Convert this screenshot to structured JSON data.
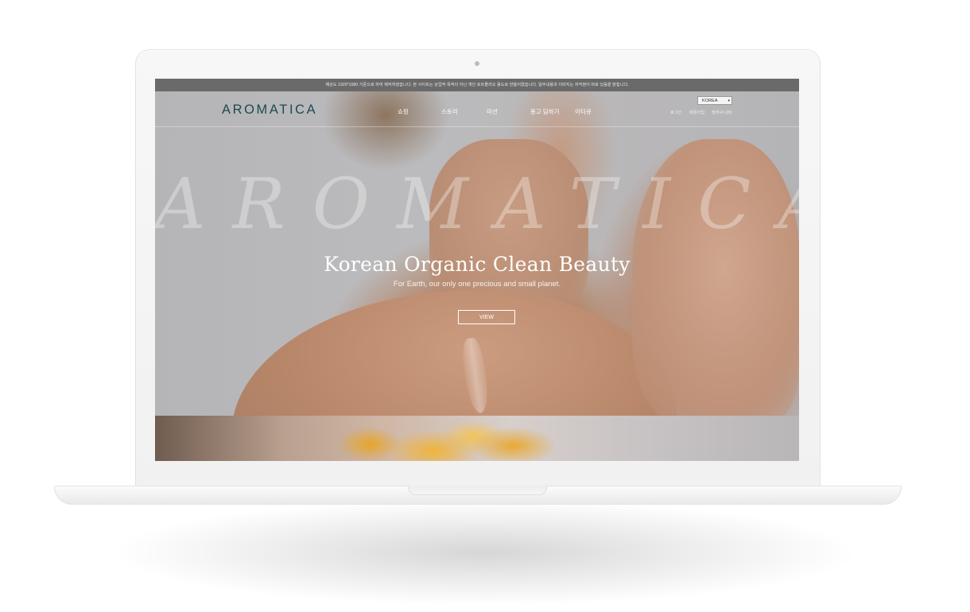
{
  "notice_bar": {
    "text": "해상도 1920*1080 기준으로 하여 제작하였습니다.   본 사이트는 상업적 목적이 아닌 개인 포트폴리오 용도로 만들어졌습니다.  일부내용과 이미지는 저작권이 따로 있음을 밝힙니다."
  },
  "header": {
    "logo": "AROMATICA",
    "nav": [
      {
        "label": "쇼핑"
      },
      {
        "label": "스토리"
      },
      {
        "label": "미션"
      },
      {
        "label": "용고 담하기"
      },
      {
        "label": "이티큐"
      }
    ],
    "language_select": {
      "value": "KOREA"
    },
    "utility_links": [
      {
        "label": "로그인"
      },
      {
        "label": "회원가입"
      },
      {
        "label": "장바구니(0)"
      }
    ]
  },
  "hero": {
    "watermark": "AROMATICA",
    "title": "Korean Organic Clean Beauty",
    "subtitle": "For Earth, our only one precious and small planet.",
    "button_label": "VIEW"
  },
  "colors": {
    "logo": "#1d4a4f",
    "notice_bar_bg": "#6a6a6a",
    "hero_bg": "#b6b6b9"
  }
}
